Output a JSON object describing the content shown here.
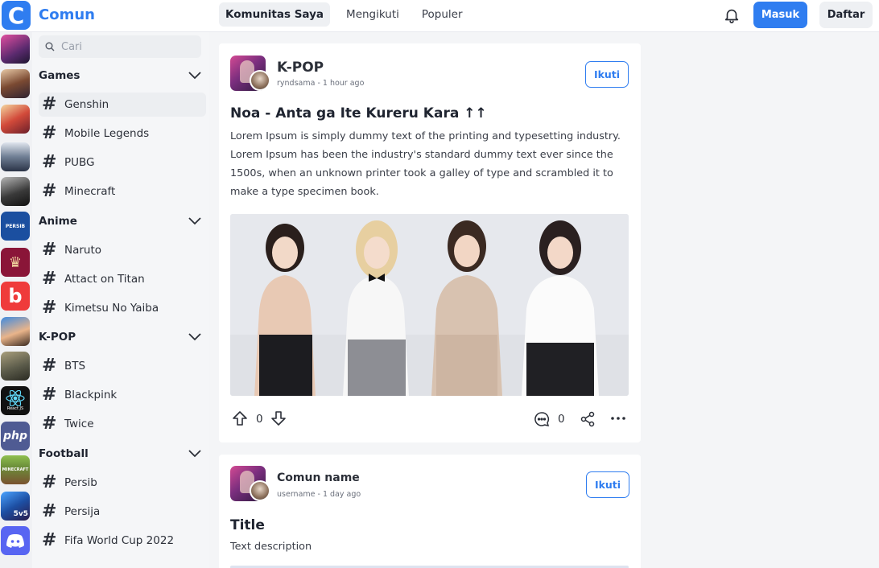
{
  "brand": {
    "name": "Comun",
    "logo_letter": "C",
    "accent": "#2f7df0"
  },
  "nav": {
    "tabs": [
      {
        "label": "Komunitas Saya",
        "active": true
      },
      {
        "label": "Mengikuti",
        "active": false
      },
      {
        "label": "Populer",
        "active": false
      }
    ]
  },
  "header": {
    "login_label": "Masuk",
    "signup_label": "Daftar",
    "bell_icon": "bell-icon"
  },
  "search": {
    "placeholder": "Cari",
    "value": ""
  },
  "sidebar": {
    "groups": [
      {
        "title": "Games",
        "items": [
          "Genshin",
          "Mobile Legends",
          "PUBG",
          "Minecraft"
        ]
      },
      {
        "title": "Anime",
        "items": [
          "Naruto",
          "Attact on Titan",
          "Kimetsu No Yaiba"
        ]
      },
      {
        "title": "K-POP",
        "items": [
          "BTS",
          "Blackpink",
          "Twice"
        ]
      },
      {
        "title": "Football",
        "items": [
          "Persib",
          "Persija",
          "Fifa World Cup 2022"
        ]
      }
    ],
    "hash_symbol": "#"
  },
  "rail": {
    "items": [
      {
        "name": "community-avatar-1",
        "color": "#b33d8f"
      },
      {
        "name": "community-avatar-2",
        "color": "#5a3b2e"
      },
      {
        "name": "community-avatar-3",
        "color": "#c0392b"
      },
      {
        "name": "community-avatar-4",
        "color": "#6c7a8c"
      },
      {
        "name": "community-avatar-5",
        "color": "#3d3d3d"
      },
      {
        "name": "persib-logo",
        "color": "#1b4fa0",
        "text": "PERSIB"
      },
      {
        "name": "world-cup-logo",
        "color": "#8a1538"
      },
      {
        "name": "b-logo",
        "color": "#ef3b3b",
        "text": "b"
      },
      {
        "name": "community-avatar-9",
        "color": "#2e6fd0"
      },
      {
        "name": "community-avatar-10",
        "color": "#5b5b4a"
      },
      {
        "name": "react-logo",
        "color": "#111111",
        "text": "React JS"
      },
      {
        "name": "php-logo",
        "color": "#4f5b93",
        "text": "php"
      },
      {
        "name": "minecraft-logo",
        "color": "#6b8e3a",
        "text": "MINECRAFT"
      },
      {
        "name": "mobile-legends-logo",
        "color": "#1d4fa3",
        "text": "5v5"
      },
      {
        "name": "discord-logo",
        "color": "#5865f2"
      }
    ]
  },
  "posts": [
    {
      "community": "K-POP",
      "author": "ryndsama",
      "time": "1 hour ago",
      "meta": "ryndsama - 1 hour ago",
      "follow_label": "Ikuti",
      "title": "Noa - Anta ga Ite Kureru Kara ↑↑",
      "body": "Lorem Ipsum is simply dummy text of the printing and typesetting industry. Lorem Ipsum has been the industry's standard dummy text ever since the 1500s, when an unknown printer took a galley of type and scrambled it to make a type specimen book.",
      "upvotes": "0",
      "comments": "0"
    },
    {
      "community": "Comun name",
      "meta": "username - 1 day ago",
      "follow_label": "Ikuti",
      "title": "Title",
      "body": "Text description"
    }
  ]
}
